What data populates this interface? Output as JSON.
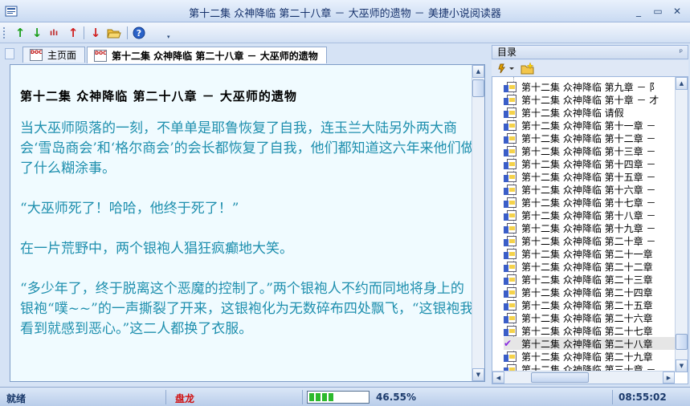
{
  "window": {
    "title": "第十二集 众神降临 第二十八章 － 大巫师的遗物 － 美捷小说阅读器",
    "controls": [
      "_",
      "▭",
      "✕"
    ]
  },
  "toolbar": {
    "buttons": [
      {
        "name": "up-arrow-icon",
        "glyph": "↑",
        "color": "#1a9e1a"
      },
      {
        "name": "down-arrow-icon",
        "glyph": "↓",
        "color": "#1a9e1a"
      },
      {
        "name": "chart-icon",
        "glyph": "ılı",
        "color": "#c03030"
      },
      {
        "name": "red-up-icon",
        "glyph": "↑",
        "color": "#d02020"
      },
      {
        "name": "red-down-icon",
        "glyph": "↓",
        "color": "#d02020"
      },
      {
        "name": "folder-open-icon",
        "glyph": "📂",
        "color": "#c99a1e"
      },
      {
        "name": "help-icon",
        "glyph": "?",
        "color": "#1d4fa8"
      }
    ]
  },
  "tabs": [
    {
      "label": "主页面",
      "active": false
    },
    {
      "label": "第十二集 众神降临 第二十八章 － 大巫师的遗物",
      "active": true
    }
  ],
  "content": {
    "chapter_title": "第十二集 众神降临 第二十八章 － 大巫师的遗物",
    "paragraphs": [
      "当大巫师陨落的一刻，不单单是耶鲁恢复了自我，连玉兰大陆另外两大商会‘雪岛商会’和‘格尔商会’的会长都恢复了自我，他们都知道这六年来他们做了什么糊涂事。",
      "“大巫师死了！哈哈，他终于死了！”",
      "在一片荒野中，两个银袍人猖狂疯癫地大笑。",
      "“多少年了，终于脱离这个恶魔的控制了。”两个银袍人不约而同地将身上的银袍“噗~~”的一声撕裂了开来，这银袍化为无数碎布四处飘飞，“这银袍我看到就感到恶心。”这二人都换了衣服。"
    ]
  },
  "directory": {
    "title": "目录",
    "pin": "ᵖ",
    "items": [
      {
        "label": "第十二集 众神降临 第九章 － 阝",
        "current": false
      },
      {
        "label": "第十二集 众神降临 第十章 － 才",
        "current": false
      },
      {
        "label": "第十二集 众神降临 请假",
        "current": false
      },
      {
        "label": "第十二集 众神降临 第十一章 －",
        "current": false
      },
      {
        "label": "第十二集 众神降临 第十二章 －",
        "current": false
      },
      {
        "label": "第十二集 众神降临 第十三章 －",
        "current": false
      },
      {
        "label": "第十二集 众神降临 第十四章 －",
        "current": false
      },
      {
        "label": "第十二集 众神降临 第十五章 －",
        "current": false
      },
      {
        "label": "第十二集 众神降临 第十六章 －",
        "current": false
      },
      {
        "label": "第十二集 众神降临 第十七章 －",
        "current": false
      },
      {
        "label": "第十二集 众神降临 第十八章 －",
        "current": false
      },
      {
        "label": "第十二集 众神降临 第十九章 －",
        "current": false
      },
      {
        "label": "第十二集 众神降临 第二十章 －",
        "current": false
      },
      {
        "label": "第十二集 众神降临 第二十一章",
        "current": false
      },
      {
        "label": "第十二集 众神降临 第二十二章",
        "current": false
      },
      {
        "label": "第十二集 众神降临 第二十三章",
        "current": false
      },
      {
        "label": "第十二集 众神降临 第二十四章",
        "current": false
      },
      {
        "label": "第十二集 众神降临 第二十五章",
        "current": false
      },
      {
        "label": "第十二集 众神降临 第二十六章",
        "current": false
      },
      {
        "label": "第十二集 众神降临 第二十七章",
        "current": false
      },
      {
        "label": "第十二集 众神降临 第二十八章",
        "current": true
      },
      {
        "label": "第十二集 众神降临 第二十九章",
        "current": false
      },
      {
        "label": "第十二集 众神降临 第三十章 －",
        "current": false
      }
    ]
  },
  "status": {
    "state": "就绪",
    "author": "盘龙",
    "progress_percent": 46.55,
    "progress_label": "46.55%",
    "time": "08:55:02",
    "author_color": "#d01010"
  }
}
